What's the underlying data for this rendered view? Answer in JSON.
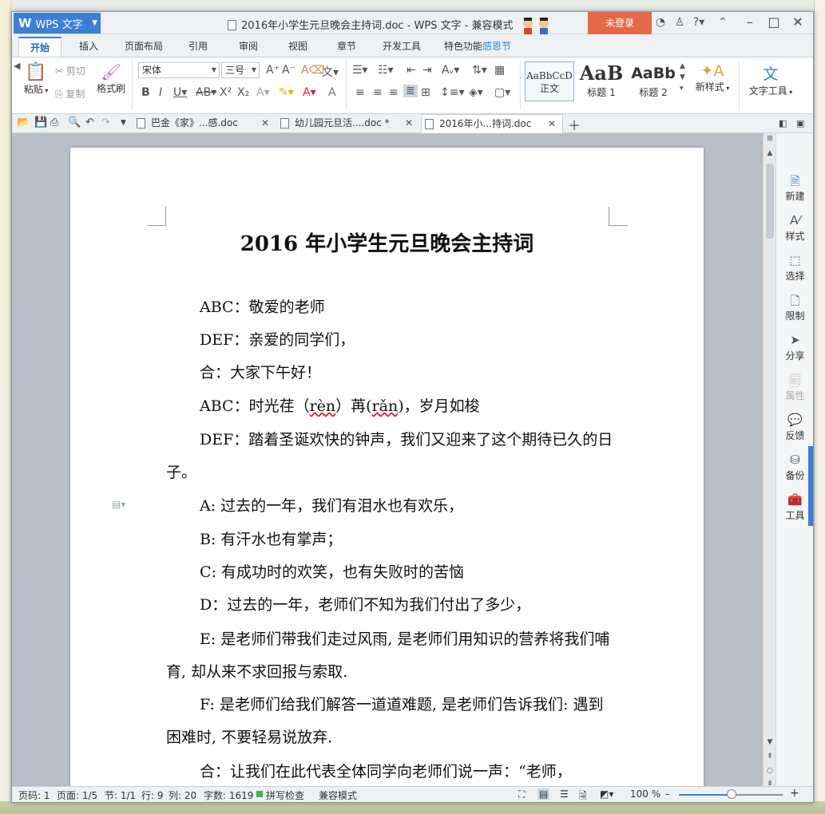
{
  "window": {
    "app_name": "WPS 文字",
    "title": "2016年小学生元旦晚会主持词.doc - WPS 文字 - 兼容模式",
    "login_label": "未登录"
  },
  "ribbon": {
    "tabs": [
      "开始",
      "插入",
      "页面布局",
      "引用",
      "审阅",
      "视图",
      "章节",
      "开发工具",
      "特色功能",
      "感恩节"
    ],
    "active_tab": "开始",
    "paste_label": "粘贴",
    "cut_label": "剪切",
    "copy_label": "复制",
    "format_painter_label": "格式刷",
    "font_name": "宋体",
    "font_size": "三号",
    "styles": [
      {
        "sample": "AaBbCcD",
        "label": "正文"
      },
      {
        "sample": "AaB",
        "label": "标题 1"
      },
      {
        "sample": "AaBb",
        "label": "标题 2"
      }
    ],
    "new_style_label": "新样式",
    "text_tools_label": "文字工具"
  },
  "doc_tabs": [
    {
      "label": "巴金《家》...感.doc",
      "active": false
    },
    {
      "label": "幼儿园元旦活....doc *",
      "active": false
    },
    {
      "label": "2016年小...持词.doc",
      "active": true
    }
  ],
  "document": {
    "title": "2016 年小学生元旦晚会主持词",
    "paragraphs": [
      "ABC：敬爱的老师",
      "DEF：亲爱的同学们，",
      "合：大家下午好！",
      "DEF：踏着圣诞欢快的钟声，我们又迎来了这个期待已久的日子。",
      "A:  过去的一年，我们有泪水也有欢乐，",
      "B:  有汗水也有掌声；",
      "C:  有成功时的欢笑，也有失败时的苦恼",
      "D：过去的一年，老师们不知为我们付出了多少，",
      "E: 是老师们带我们走过风雨, 是老师们用知识的营养将我们哺育, 却从来不求回报与索取.",
      "F: 是老师们给我们解答一道道难题, 是老师们告诉我们: 遇到困难时, 不要轻易说放弃.",
      "合：让我们在此代表全体同学向老师们说一声：“老师，"
    ],
    "line_four": {
      "prefix": "ABC：时光荏（",
      "pinyin1": "rèn",
      "middle": "）苒(",
      "pinyin2": "rǎn",
      "suffix": ")，岁月如梭"
    }
  },
  "side_panel": {
    "items": [
      "新建",
      "样式",
      "选择",
      "限制",
      "分享",
      "属性",
      "反馈",
      "备份",
      "工具"
    ]
  },
  "status": {
    "page_code": "页码: 1",
    "pages": "页面: 1/5",
    "section": "节: 1/1",
    "row": "行: 9",
    "column": "列: 20",
    "word_count": "字数: 1619",
    "spellcheck": "拼写检查",
    "mode": "兼容模式",
    "zoom": "100 %",
    "zoom_level": 0.5
  }
}
